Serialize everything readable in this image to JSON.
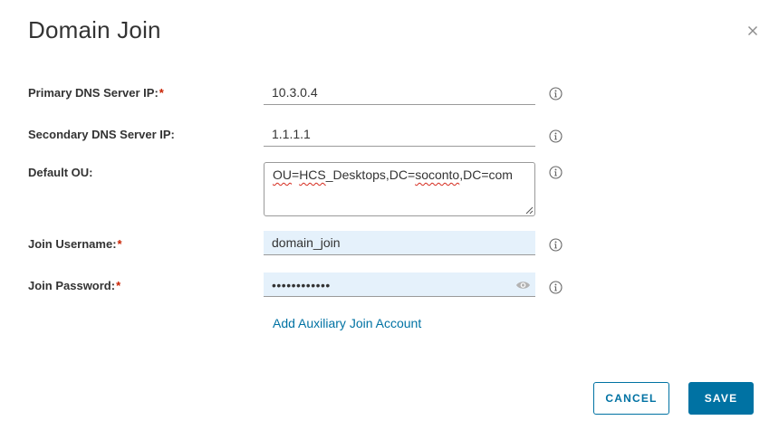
{
  "dialog": {
    "title": "Domain Join"
  },
  "fields": {
    "primary_dns": {
      "label": "Primary DNS Server IP:",
      "required": "*",
      "value": "10.3.0.4"
    },
    "secondary_dns": {
      "label": "Secondary DNS Server IP:",
      "value": "1.1.1.1"
    },
    "default_ou": {
      "label": "Default OU:",
      "value": "OU=HCS_Desktops,DC=soconto,DC=com",
      "value_parts": [
        "OU",
        "=",
        "HCS",
        "_Desktops,DC=",
        "soconto",
        ",DC=com"
      ]
    },
    "join_username": {
      "label": "Join Username:",
      "required": "*",
      "value": "domain_join"
    },
    "join_password": {
      "label": "Join Password:",
      "required": "*",
      "masked_value": "••••••••••••"
    }
  },
  "links": {
    "add_auxiliary": "Add Auxiliary Join Account"
  },
  "buttons": {
    "cancel": "CANCEL",
    "save": "SAVE"
  },
  "colors": {
    "accent": "#0072a3",
    "required": "#c92100",
    "autofill_bg": "#e5f1fb",
    "spellcheck": "#d52b1e"
  },
  "icons": {
    "close": "close-icon",
    "info": "info-icon",
    "eye": "eye-icon"
  }
}
